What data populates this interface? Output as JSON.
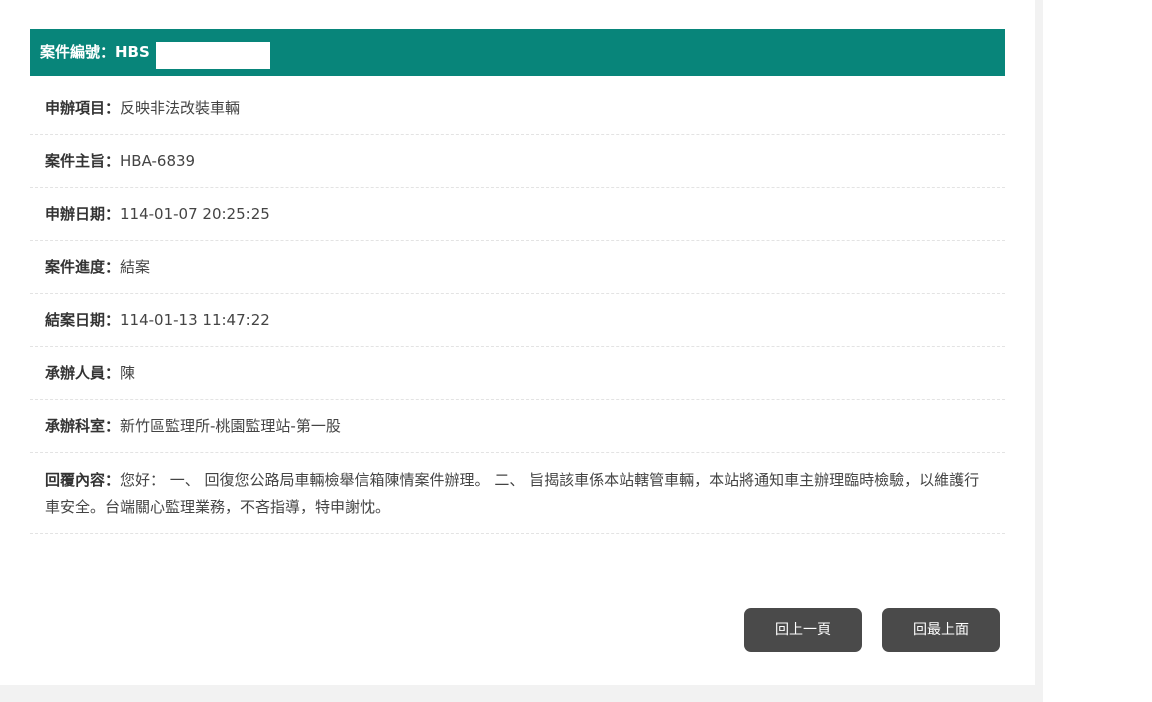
{
  "case": {
    "header_label": "案件編號：HBS",
    "rows": [
      {
        "label": "申辦項目：",
        "value": "反映非法改裝車輛"
      },
      {
        "label": "案件主旨：",
        "value": "HBA-6839"
      },
      {
        "label": "申辦日期：",
        "value": "114-01-07 20:25:25"
      },
      {
        "label": "案件進度：",
        "value": "結案"
      },
      {
        "label": "結案日期：",
        "value": "114-01-13 11:47:22"
      },
      {
        "label": "承辦人員：",
        "value": "陳"
      },
      {
        "label": "承辦科室：",
        "value": "新竹區監理所-桃園監理站-第一股"
      }
    ],
    "reply": {
      "label": "回覆內容：",
      "value": "您好： 一、 回復您公路局車輛檢舉信箱陳情案件辦理。 二、 旨揭該車係本站轄管車輛，本站將通知車主辦理臨時檢驗，以維護行車安全。台端關心監理業務，不吝指導，特申謝忱。"
    }
  },
  "buttons": {
    "prev_label": "回上一頁",
    "top_label": "回最上面"
  },
  "colors": {
    "header_bg": "#08857a",
    "button_bg": "#4a4a4a"
  }
}
